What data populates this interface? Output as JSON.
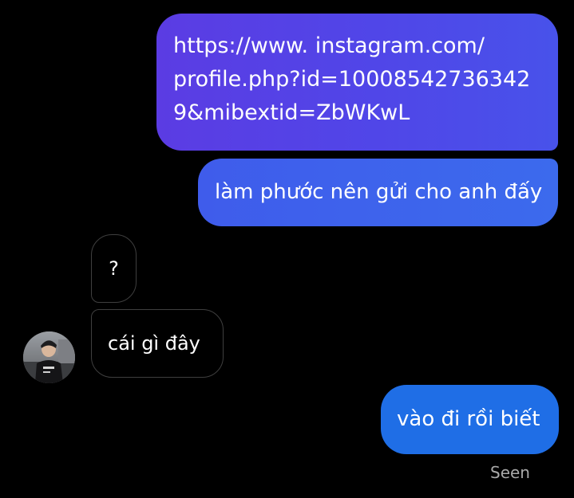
{
  "colors": {
    "background": "#000000",
    "sent_gradient_start": "#5b3ce3",
    "sent_gradient_end": "#3c6aed",
    "sent_last": "#1f6ee6",
    "received_border": "#3f3f3f",
    "seen_text": "#a9a9a9"
  },
  "messages": {
    "link": {
      "line1": "https://www. instagram.com/",
      "line2": "profile.php?id=10008542736342",
      "line3": "9&mibextid=ZbWKwL"
    },
    "sent_2": "làm phước nên gửi cho anh đấy",
    "received_1": "?",
    "received_2": "cái gì đây",
    "sent_3": "vào đi rồi biết"
  },
  "contact": {
    "avatar_icon": "user-avatar-photo"
  },
  "status": {
    "seen": "Seen"
  }
}
